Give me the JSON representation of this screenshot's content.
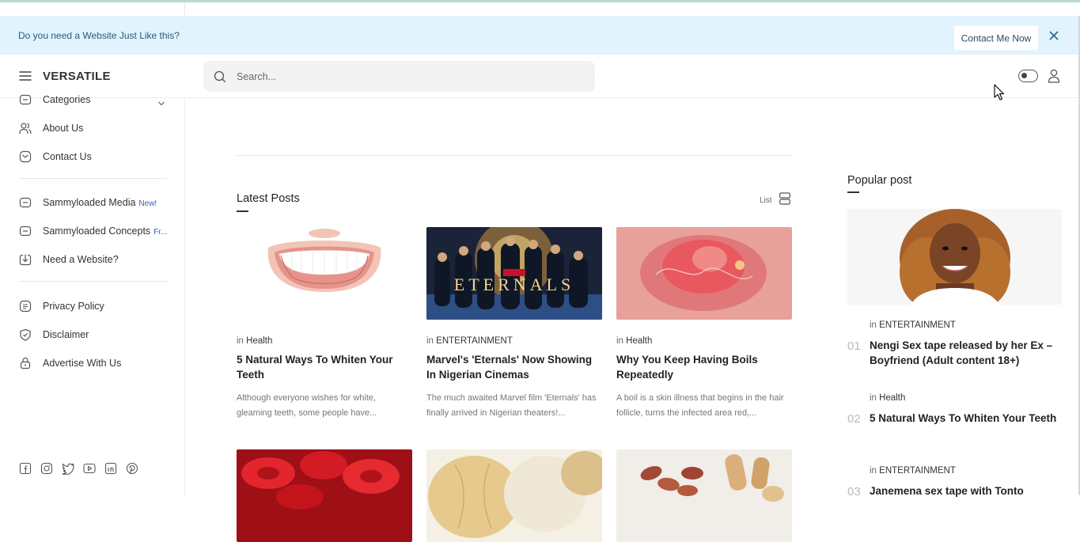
{
  "banner": {
    "message": "Do you need a Website Just Like this?",
    "cta_label": "Contact Me Now"
  },
  "header": {
    "brand": "VERSATILE",
    "search_placeholder": "Search..."
  },
  "sidebar": {
    "items": [
      {
        "label": "Categories",
        "icon": "folder-icon"
      },
      {
        "label": "About Us",
        "icon": "users-icon"
      },
      {
        "label": "Contact Us",
        "icon": "mail-icon"
      },
      {
        "label": "Sammyloaded Media",
        "badge": "New!",
        "icon": "folder-icon"
      },
      {
        "label": "Sammyloaded Concepts",
        "badge": "Fr...",
        "icon": "folder-icon"
      },
      {
        "label": "Need a Website?",
        "icon": "download-icon"
      },
      {
        "label": "Privacy Policy",
        "icon": "document-icon"
      },
      {
        "label": "Disclaimer",
        "icon": "shield-icon"
      },
      {
        "label": "Advertise With Us",
        "icon": "lock-icon"
      }
    ],
    "socials": [
      "facebook-icon",
      "instagram-icon",
      "twitter-icon",
      "youtube-icon",
      "linkedin-icon",
      "pinterest-icon"
    ]
  },
  "main": {
    "section_title": "Latest Posts",
    "view_label": "List",
    "cards": [
      {
        "in": "in",
        "category": "Health",
        "title": "5 Natural Ways To Whiten Your Teeth",
        "excerpt": "Although everyone wishes for white, gleaming teeth, some people have..."
      },
      {
        "in": "in",
        "category": "ENTERTAINMENT",
        "title": "Marvel's 'Eternals' Now Showing In Nigerian Cinemas",
        "excerpt": "The much awaited Marvel film 'Eternals' has finally arrived in Nigerian theaters!..."
      },
      {
        "in": "in",
        "category": "Health",
        "title": "Why You Keep Having Boils Repeatedly",
        "excerpt": "A boil is a skin illness that begins in the hair follicle, turns the infected area red,..."
      }
    ],
    "movie_text": "ETERNALS"
  },
  "popular": {
    "title": "Popular post",
    "items": [
      {
        "num": "01",
        "in": "in",
        "category": "ENTERTAINMENT",
        "title": "Nengi Sex tape released by her Ex – Boyfriend (Adult content 18+)"
      },
      {
        "num": "02",
        "in": "in",
        "category": "Health",
        "title": "5 Natural Ways To Whiten Your Teeth"
      },
      {
        "num": "03",
        "in": "in",
        "category": "ENTERTAINMENT",
        "title": "Janemena sex tape with Tonto"
      }
    ]
  }
}
